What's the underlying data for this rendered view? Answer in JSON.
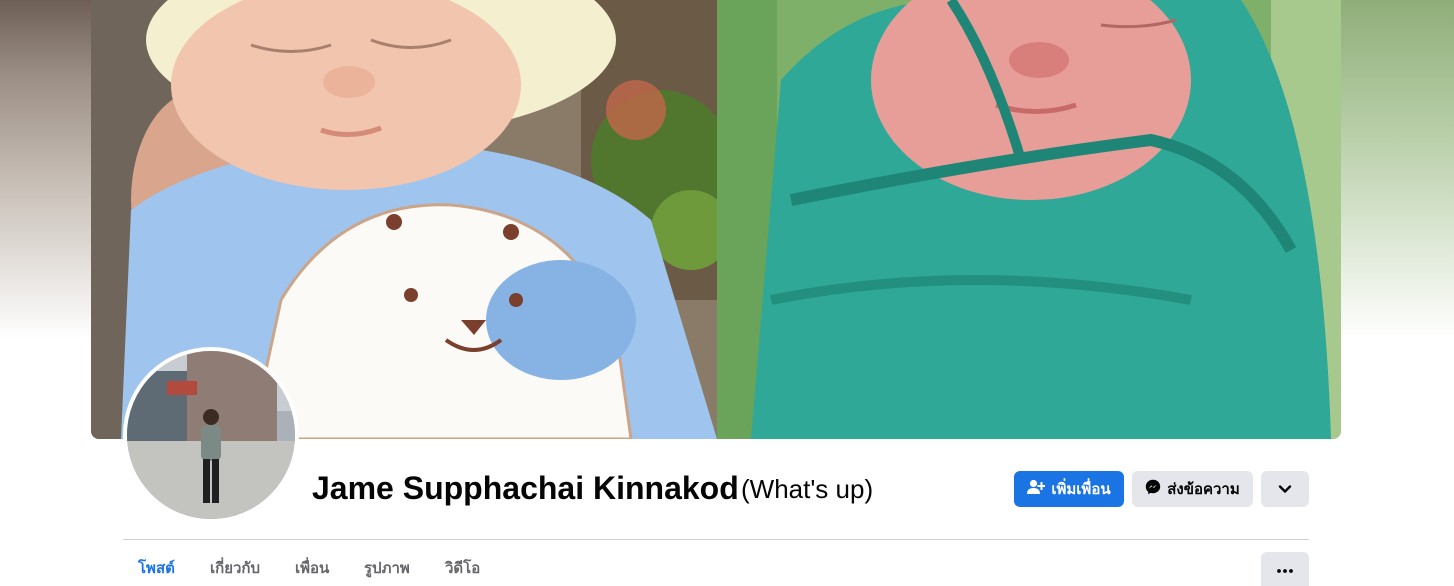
{
  "profile": {
    "name": "Jame Supphachai Kinnakod",
    "alternate_name": "(What's up)"
  },
  "actions": {
    "add_friend_label": "เพิ่มเพื่อน",
    "message_label": "ส่งข้อความ",
    "more_icon": "chevron-down-icon"
  },
  "tabs": [
    {
      "label": "โพสต์",
      "active": true
    },
    {
      "label": "เกี่ยวกับ",
      "active": false
    },
    {
      "label": "เพื่อน",
      "active": false
    },
    {
      "label": "รูปภาพ",
      "active": false
    },
    {
      "label": "วิดีโอ",
      "active": false
    }
  ],
  "tab_overflow_icon": "ellipsis-icon",
  "colors": {
    "accent": "#1b74e4",
    "secondary_button": "#e4e6eb",
    "text_primary": "#050505",
    "text_secondary": "#65676b"
  }
}
